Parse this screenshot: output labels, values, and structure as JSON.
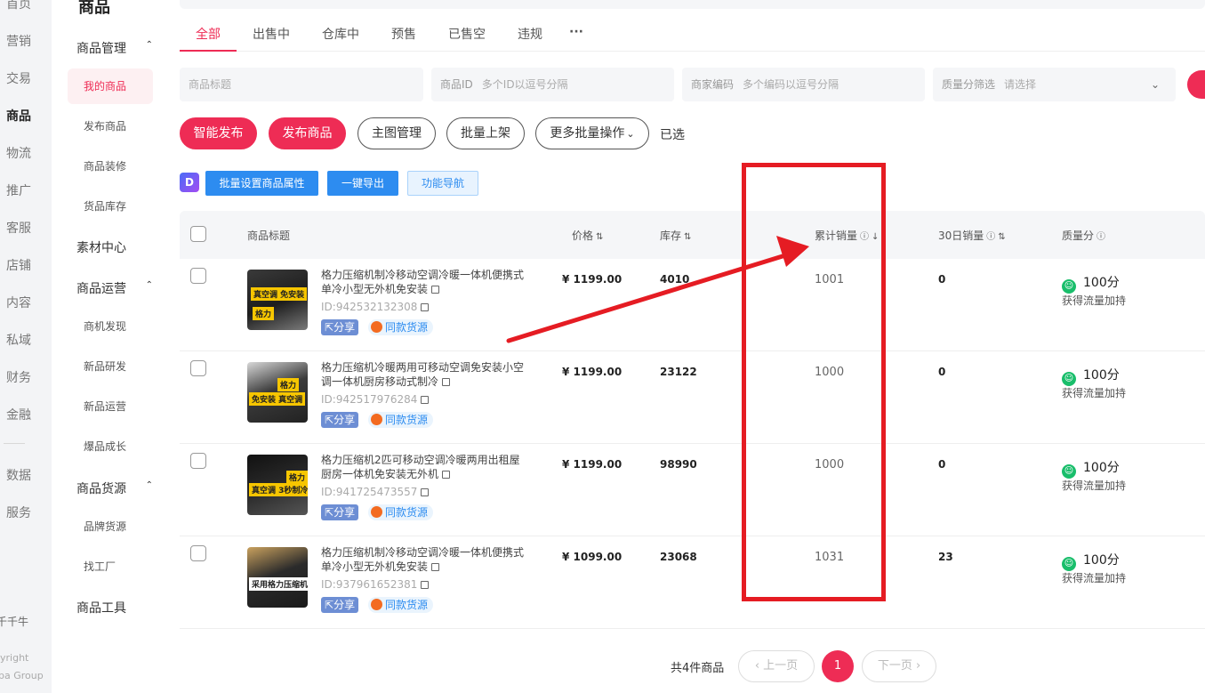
{
  "rail": {
    "items": [
      "首页",
      "营销",
      "交易",
      "商品",
      "物流",
      "推广",
      "客服",
      "店铺",
      "内容",
      "私域",
      "财务",
      "金融",
      "数据",
      "服务"
    ],
    "footer": [
      "千千牛",
      "yright",
      "ba Group"
    ]
  },
  "sidebar": {
    "title": "商品",
    "groups": {
      "manage": "商品管理",
      "material": "素材中心",
      "ops": "商品运营",
      "source": "商品货源",
      "tools": "商品工具"
    },
    "subs": {
      "mine": "我的商品",
      "publish": "发布商品",
      "decorate": "商品装修",
      "inventory": "货品库存",
      "discover": "商机发现",
      "research": "新品研发",
      "newops": "新品运营",
      "hot": "爆品成长",
      "brand": "品牌货源",
      "factory": "找工厂"
    }
  },
  "tabs": [
    "全部",
    "出售中",
    "仓库中",
    "预售",
    "已售空",
    "违规",
    "···"
  ],
  "filters": {
    "title_placeholder": "商品标题",
    "id_label": "商品ID",
    "id_placeholder": "多个ID以逗号分隔",
    "code_label": "商家编码",
    "code_placeholder": "多个编码以逗号分隔",
    "quality_label": "质量分筛选",
    "quality_placeholder": "请选择"
  },
  "actions": {
    "smart_publish": "智能发布",
    "publish": "发布商品",
    "main_image": "主图管理",
    "batch_list": "批量上架",
    "more_batch": "更多批量操作",
    "selected": "已选"
  },
  "tools": {
    "logo": "D",
    "batch_attr": "批量设置商品属性",
    "export": "一键导出",
    "nav": "功能导航"
  },
  "table": {
    "headers": {
      "title": "商品标题",
      "price": "价格",
      "stock": "库存",
      "total_sales": "累计销量",
      "sales30": "30日销量",
      "quality": "质量分"
    },
    "share_label": "分享",
    "same_label": "同款货源",
    "quality_note": "获得流量加持",
    "rows": [
      {
        "title": "格力压缩机制冷移动空调冷暖一体机便携式单冷小型无外机免安装",
        "id": "ID:942532132308",
        "price": "¥ 1199.00",
        "stock": "4010",
        "total_sales": "1001",
        "sales30": "0",
        "quality": "100分",
        "thumb_tags": [
          "真空调 免安装",
          "格力"
        ]
      },
      {
        "title": "格力压缩机冷暖两用可移动空调免安装小空调一体机厨房移动式制冷",
        "id": "ID:942517976284",
        "price": "¥ 1199.00",
        "stock": "23122",
        "total_sales": "1000",
        "sales30": "0",
        "quality": "100分",
        "thumb_tags": [
          "格力",
          "免安装 真空调"
        ]
      },
      {
        "title": "格力压缩机2匹可移动空调冷暖两用出租屋厨房一体机免安装无外机",
        "id": "ID:941725473557",
        "price": "¥ 1199.00",
        "stock": "98990",
        "total_sales": "1000",
        "sales30": "0",
        "quality": "100分",
        "thumb_tags": [
          "格力",
          "真空调 3秒制冷"
        ]
      },
      {
        "title": "格力压缩机制冷移动空调冷暖一体机便携式单冷小型无外机免安装",
        "id": "ID:937961652381",
        "price": "¥ 1099.00",
        "stock": "23068",
        "total_sales": "1031",
        "sales30": "23",
        "quality": "100分",
        "thumb_tags": [
          "采用格力压缩机"
        ]
      }
    ]
  },
  "pagination": {
    "total": "共4件商品",
    "prev": "‹ 上一页",
    "current": "1",
    "next": "下一页 ›"
  },
  "colors": {
    "accent": "#ee2c55",
    "blue": "#2d8cf0",
    "annotation_red": "#e51c23"
  }
}
